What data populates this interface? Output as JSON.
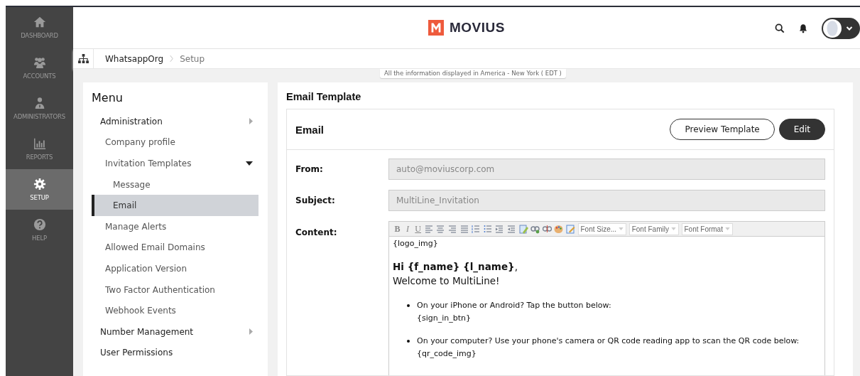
{
  "sidebar": {
    "items": [
      {
        "kind": "home",
        "label": "DASHBOARD",
        "selected": false
      },
      {
        "kind": "users",
        "label": "ACCOUNTS",
        "selected": false
      },
      {
        "kind": "admin",
        "label": "ADMINISTRATORS",
        "selected": false
      },
      {
        "kind": "chart",
        "label": "REPORTS",
        "selected": false
      },
      {
        "kind": "gear",
        "label": "SETUP",
        "selected": true
      },
      {
        "kind": "help",
        "label": "HELP",
        "selected": false
      }
    ]
  },
  "header": {
    "brand": "MOVIUS"
  },
  "breadcrumb": {
    "items": [
      "WhatsappOrg",
      "Setup"
    ]
  },
  "timezone_notice": "All the information displayed in America - New York ( EDT )",
  "menu": {
    "title": "Menu",
    "items": [
      {
        "label": "Administration",
        "expanded": false,
        "children": [
          {
            "label": "Company profile",
            "selected": false
          },
          {
            "label": "Invitation Templates",
            "expanded": true,
            "children": [
              {
                "label": "Message",
                "selected": false
              },
              {
                "label": "Email",
                "selected": true
              }
            ]
          },
          {
            "label": "Manage Alerts",
            "selected": false
          },
          {
            "label": "Allowed Email Domains",
            "selected": false
          },
          {
            "label": "Application Version",
            "selected": false
          },
          {
            "label": "Two Factor Authentication",
            "selected": false
          },
          {
            "label": "Webhook Events",
            "selected": false
          }
        ]
      },
      {
        "label": "Number Management",
        "expanded": false
      },
      {
        "label": "User Permissions",
        "selected": false
      }
    ]
  },
  "page_title": "Email Template",
  "card": {
    "title": "Email",
    "buttons": [
      {
        "kind": "outline",
        "label": "Preview Template"
      },
      {
        "kind": "primary",
        "label": "Edit"
      }
    ],
    "fields": [
      {
        "label": "From:",
        "value": "auto@moviuscorp.com",
        "disabled": true
      },
      {
        "label": "Subject:",
        "value": "MultiLine_Invitation",
        "disabled": true
      }
    ],
    "content": {
      "label": "Content:",
      "toolbar": [
        {
          "kind": "bold",
          "label": "B"
        },
        {
          "kind": "italic",
          "label": "I"
        },
        {
          "kind": "underline",
          "label": "U"
        },
        {
          "kind": "align-left"
        },
        {
          "kind": "align-center"
        },
        {
          "kind": "align-right"
        },
        {
          "kind": "justify"
        },
        {
          "kind": "ordered-list"
        },
        {
          "kind": "bullet-list"
        },
        {
          "kind": "outdent"
        },
        {
          "kind": "indent"
        },
        {
          "kind": "clean"
        },
        {
          "kind": "link"
        },
        {
          "kind": "unlink"
        },
        {
          "kind": "palette"
        },
        {
          "kind": "source"
        },
        {
          "kind": "select",
          "label": "Font Size..."
        },
        {
          "kind": "select",
          "label": "Font Family"
        },
        {
          "kind": "select",
          "label": "Font Format"
        }
      ],
      "blocks": [
        {
          "kind": "small",
          "lines": [
            "{logo_img}"
          ]
        },
        {
          "kind": "large",
          "lines": [
            "**Hi {f_name} {l_name}**,",
            "Welcome to MultiLine!"
          ]
        },
        {
          "kind": "bullet",
          "lines": [
            "On your iPhone or Android? Tap the button below:",
            "{sign_in_btn}"
          ]
        },
        {
          "kind": "bullet",
          "lines": [
            "On your computer? Use your phone's camera or QR code reading app to scan the QR code below:",
            "{qr_code_img}"
          ]
        }
      ]
    }
  }
}
